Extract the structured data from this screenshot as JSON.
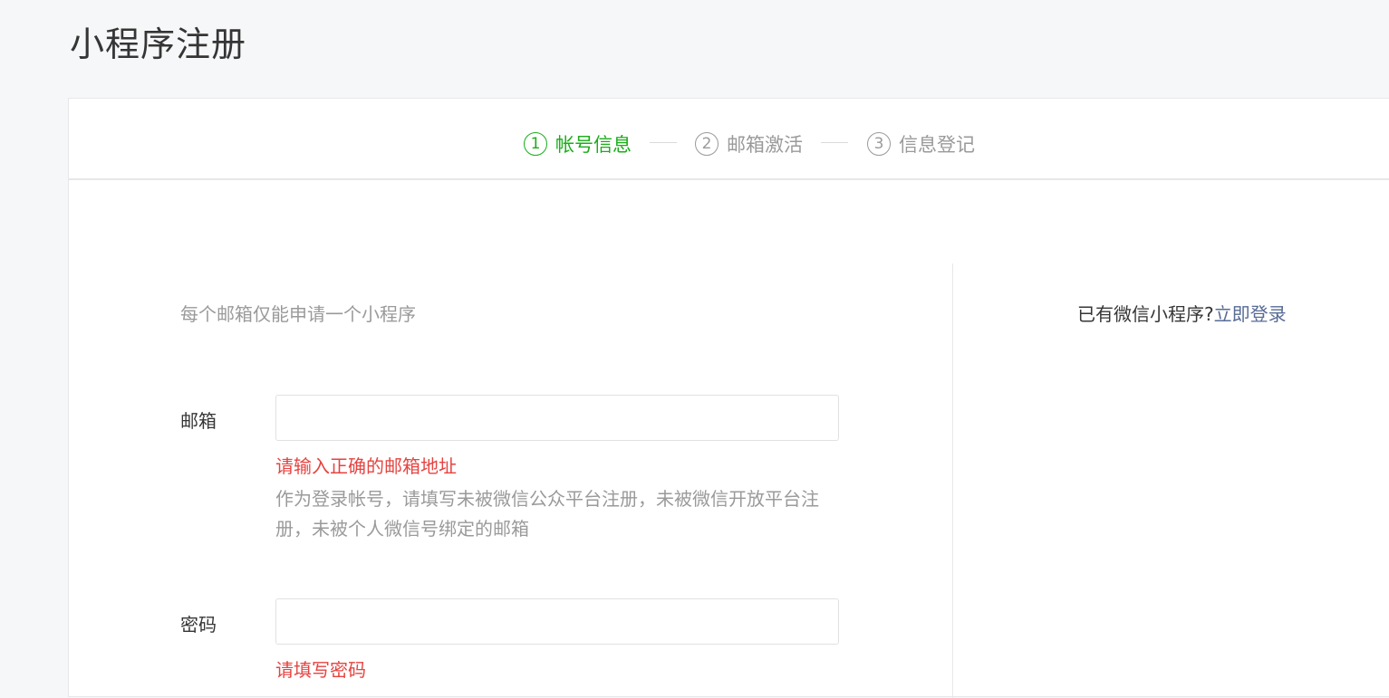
{
  "page": {
    "title": "小程序注册"
  },
  "steps": [
    {
      "num": "1",
      "label": "帐号信息",
      "active": true
    },
    {
      "num": "2",
      "label": "邮箱激活",
      "active": false
    },
    {
      "num": "3",
      "label": "信息登记",
      "active": false
    }
  ],
  "form": {
    "intro": "每个邮箱仅能申请一个小程序",
    "email": {
      "label": "邮箱",
      "value": "",
      "error": "请输入正确的邮箱地址",
      "hint": "作为登录帐号，请填写未被微信公众平台注册，未被微信开放平台注册，未被个人微信号绑定的邮箱"
    },
    "password": {
      "label": "密码",
      "value": "",
      "error": "请填写密码"
    }
  },
  "side": {
    "prompt": "已有微信小程序?",
    "login_link": "立即登录"
  },
  "colors": {
    "active_step": "#1aad19",
    "error": "#e64340",
    "link": "#576b95",
    "muted": "#9a9a9a"
  }
}
